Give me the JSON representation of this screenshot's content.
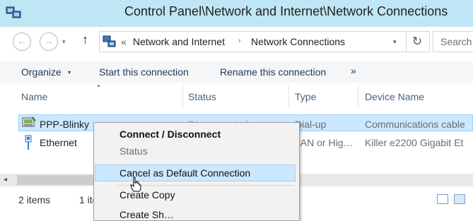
{
  "window": {
    "title": "Control Panel\\Network and Internet\\Network Connections"
  },
  "address_bar": {
    "overflow_chevron": "«",
    "crumbs": [
      "Network and Internet",
      "Network Connections"
    ],
    "separator": "›",
    "refresh_glyph": "↻",
    "search_placeholder": "Search"
  },
  "nav": {
    "back_glyph": "←",
    "forward_glyph": "→",
    "recent_glyph": "▾",
    "up_glyph": "↑"
  },
  "command_bar": {
    "organize_label": "Organize",
    "organize_arrow": "▾",
    "start_connection_label": "Start this connection",
    "rename_connection_label": "Rename this connection",
    "more_label": "»"
  },
  "columns": {
    "name": "Name",
    "status": "Status",
    "type": "Type",
    "device_name": "Device Name",
    "sort_caret": "▲"
  },
  "connections": [
    {
      "name": "PPP-Blinky",
      "status": "Disconnected",
      "type": "Dial-up",
      "device_name": "Communications cable",
      "icon": "dialup-connection-icon",
      "selected": true
    },
    {
      "name": "Ethernet",
      "status": "",
      "type": "LAN or Hig…",
      "device_name": "Killer e2200 Gigabit Et",
      "icon": "ethernet-connection-icon",
      "selected": false
    }
  ],
  "scrollbar": {
    "left_arrow": "◂"
  },
  "status_bar": {
    "item_count": "2 items",
    "selected_count": "1 ite"
  },
  "context_menu": {
    "items": [
      {
        "label": "Connect / Disconnect",
        "style": "bold"
      },
      {
        "label": "Status",
        "style": "disabled"
      },
      {
        "label": "Cancel as Default Connection",
        "style": "highlighted"
      },
      {
        "label": "Create Copy",
        "style": "normal"
      },
      {
        "label": "Create Sh…",
        "style": "normal"
      }
    ]
  },
  "colors": {
    "titlebar_bg": "#bfe6f4",
    "selection_bg": "#cce8ff",
    "selection_border": "#99d1ff",
    "command_text": "#1e395b",
    "header_text": "#4c607a",
    "menu_bg": "#f2f2f2"
  }
}
